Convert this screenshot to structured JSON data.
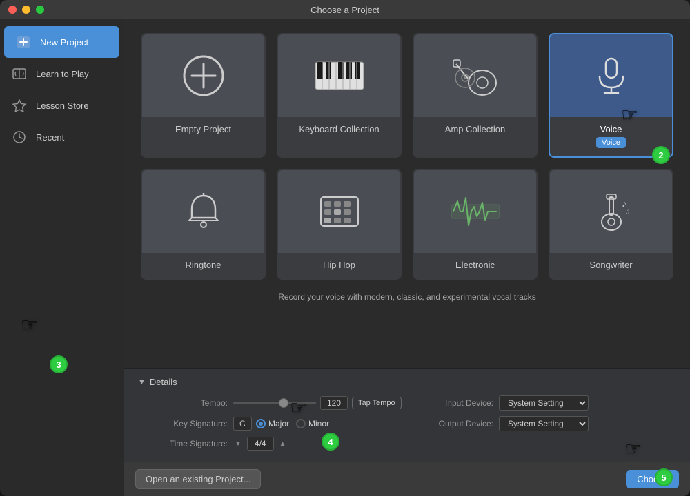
{
  "window": {
    "title": "Choose a Project"
  },
  "sidebar": {
    "items": [
      {
        "id": "new-project",
        "label": "New Project",
        "icon": "new",
        "active": true
      },
      {
        "id": "learn-to-play",
        "label": "Learn to Play",
        "icon": "learn",
        "active": false
      },
      {
        "id": "lesson-store",
        "label": "Lesson Store",
        "icon": "store",
        "active": false
      },
      {
        "id": "recent",
        "label": "Recent",
        "icon": "recent",
        "active": false
      }
    ]
  },
  "projects": {
    "row1": [
      {
        "id": "empty-project",
        "label": "Empty Project",
        "selected": false,
        "badge": ""
      },
      {
        "id": "keyboard-collection",
        "label": "Keyboard Collection",
        "selected": false,
        "badge": ""
      },
      {
        "id": "amp-collection",
        "label": "Amp Collection",
        "selected": false,
        "badge": ""
      },
      {
        "id": "voice",
        "label": "Voice",
        "selected": true,
        "badge": "Voice"
      }
    ],
    "row2": [
      {
        "id": "ringtone",
        "label": "Ringtone",
        "selected": false,
        "badge": ""
      },
      {
        "id": "hip-hop",
        "label": "Hip Hop",
        "selected": false,
        "badge": ""
      },
      {
        "id": "electronic",
        "label": "Electronic",
        "selected": false,
        "badge": ""
      },
      {
        "id": "songwriter",
        "label": "Songwriter",
        "selected": false,
        "badge": ""
      }
    ]
  },
  "description": "Record your voice with modern, classic, and experimental vocal tracks",
  "details": {
    "header": "Details",
    "tempo_label": "Tempo:",
    "tempo_value": "120",
    "tap_tempo_label": "Tap Tempo",
    "key_signature_label": "Key Signature:",
    "key_value": "C",
    "major_label": "Major",
    "minor_label": "Minor",
    "time_signature_label": "Time Signature:",
    "time_sig_value": "4/4",
    "input_device_label": "Input Device:",
    "input_device_value": "System Setting",
    "output_device_label": "Output Device:",
    "output_device_value": "System Setting"
  },
  "bottom": {
    "open_btn": "Open an existing Project...",
    "choose_btn": "Choose"
  },
  "steps": {
    "step2": "2",
    "step3": "3",
    "step4": "4",
    "step5": "5"
  }
}
